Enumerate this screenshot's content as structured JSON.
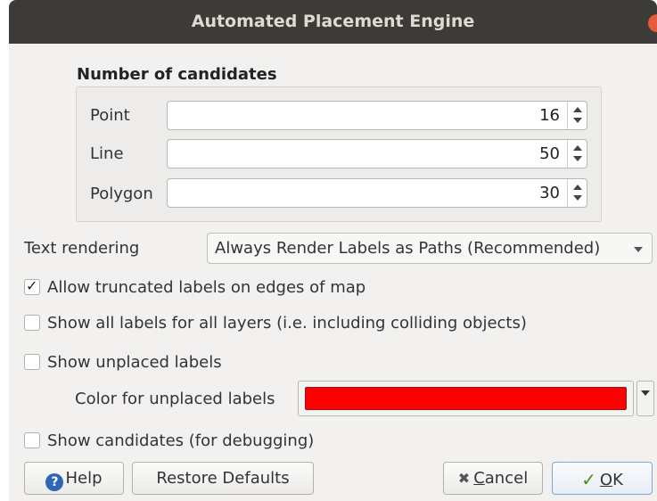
{
  "window": {
    "title": "Automated Placement Engine"
  },
  "candidates": {
    "heading": "Number of candidates",
    "fields": [
      {
        "label": "Point",
        "value": "16"
      },
      {
        "label": "Line",
        "value": "50"
      },
      {
        "label": "Polygon",
        "value": "30"
      }
    ]
  },
  "text_rendering": {
    "label": "Text rendering",
    "selected": "Always Render Labels as Paths (Recommended)"
  },
  "options": {
    "allow_truncated": {
      "label": "Allow truncated labels on edges of map",
      "checked": true
    },
    "show_all_labels": {
      "label": "Show all labels for all layers (i.e. including colliding objects)",
      "checked": false
    },
    "show_unplaced": {
      "label": "Show unplaced labels",
      "checked": false
    },
    "unplaced_color_label": "Color for unplaced labels",
    "unplaced_color": "#ff0000",
    "show_candidates": {
      "label": "Show candidates (for debugging)",
      "checked": false
    }
  },
  "buttons": {
    "help": "Help",
    "restore_defaults": "Restore Defaults",
    "cancel_prefix": "",
    "cancel_mnemonic": "C",
    "cancel_rest": "ancel",
    "ok_mnemonic": "O",
    "ok_rest": "K"
  },
  "icons": {
    "help": "help-icon",
    "cancel": "cancel-x-icon",
    "ok": "checkmark-icon",
    "close": "close-icon"
  }
}
